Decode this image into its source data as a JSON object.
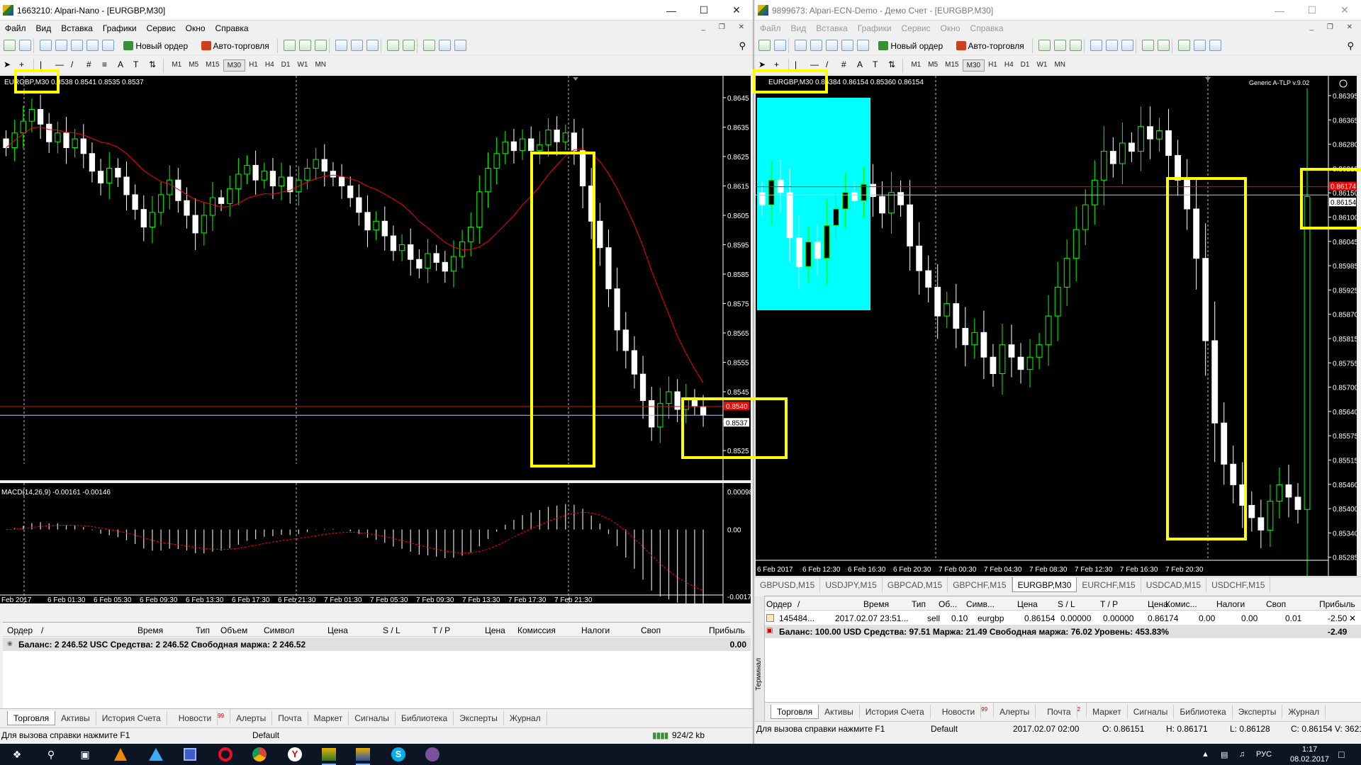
{
  "left": {
    "title": "1663210: Alpari-Nano - [EURGBP,M30]",
    "menu": [
      "Файл",
      "Вид",
      "Вставка",
      "Графики",
      "Сервис",
      "Окно",
      "Справка"
    ],
    "toolbar": {
      "new_order": "Новый ордер",
      "auto_trading": "Авто-торговля"
    },
    "timeframes": [
      "M1",
      "M5",
      "M15",
      "M30",
      "H1",
      "H4",
      "D1",
      "W1",
      "MN"
    ],
    "selected_timeframe": "M30",
    "chart_header": "EURGBP,M30  0.8538 0.8541 0.8535 0.8537",
    "macd_label": "MACD(14,26,9) -0.00161 -0.00146",
    "yticks": [
      "0.8645",
      "0.8635",
      "0.8625",
      "0.8615",
      "0.8605",
      "0.8595",
      "0.8585",
      "0.8575",
      "0.8565",
      "0.8555",
      "0.8545",
      "0.8535",
      "0.8525"
    ],
    "macd_yticks": [
      "0.00098",
      "0.00",
      "-0.00173"
    ],
    "xticks": [
      "Feb 2017",
      "6 Feb 01:30",
      "6 Feb 05:30",
      "6 Feb 09:30",
      "6 Feb 13:30",
      "6 Feb 17:30",
      "6 Feb 21:30",
      "7 Feb 01:30",
      "7 Feb 05:30",
      "7 Feb 09:30",
      "7 Feb 13:30",
      "7 Feb 17:30",
      "7 Feb 21:30"
    ],
    "ask_label": "0.8540",
    "bid_label": "0.8537",
    "terminal_headers": [
      "Ордер",
      "/",
      "Время",
      "Тип",
      "Объем",
      "Символ",
      "Цена",
      "S / L",
      "T / P",
      "Цена",
      "Комиссия",
      "Налоги",
      "Своп",
      "Прибыль"
    ],
    "balance_line": "Баланс: 2 246.52 USC  Средства: 2 246.52  Свободная маржа: 2 246.52",
    "balance_profit": "0.00",
    "tabs": [
      "Торговля",
      "Активы",
      "История Счета",
      "Новости",
      "Алерты",
      "Почта",
      "Маркет",
      "Сигналы",
      "Библиотека",
      "Эксперты",
      "Журнал"
    ],
    "news_badge": "99",
    "status": {
      "help": "Для вызова справки нажмите F1",
      "profile": "Default",
      "traffic": "924/2 kb"
    }
  },
  "right": {
    "title": "9899673: Alpari-ECN-Demo - Демо Счет - [EURGBP,M30]",
    "menu": [
      "Файл",
      "Вид",
      "Вставка",
      "Графики",
      "Сервис",
      "Окно",
      "Справка"
    ],
    "toolbar": {
      "new_order": "Новый ордер",
      "auto_trading": "Авто-торговля"
    },
    "timeframes": [
      "M1",
      "M5",
      "M15",
      "M30",
      "H1",
      "H4",
      "D1",
      "W1",
      "MN"
    ],
    "selected_timeframe": "M30",
    "chart_header": "EURGBP,M30  0.86384 0.86154 0.85360 0.86154",
    "indicator": "Generic A-TLP v.9.02",
    "yticks": [
      "0.86395",
      "0.86365",
      "0.86280",
      "0.86215",
      "0.86150",
      "0.86100",
      "0.86045",
      "0.85985",
      "0.85925",
      "0.85870",
      "0.85815",
      "0.85755",
      "0.85700",
      "0.85640",
      "0.85575",
      "0.85515",
      "0.85460",
      "0.85400",
      "0.85340",
      "0.85285"
    ],
    "xticks": [
      "6 Feb 2017",
      "6 Feb 12:30",
      "6 Feb 16:30",
      "6 Feb 20:30",
      "7 Feb 00:30",
      "7 Feb 04:30",
      "7 Feb 08:30",
      "7 Feb 12:30",
      "7 Feb 16:30",
      "7 Feb 20:30"
    ],
    "ask_label": "0.86174",
    "bid_label": "0.86154",
    "symbol_tabs": [
      "GBPUSD,M15",
      "USDJPY,M15",
      "GBPCAD,M15",
      "GBPCHF,M15",
      "EURGBP,M30",
      "EURCHF,M15",
      "USDCAD,M15",
      "USDCHF,M15"
    ],
    "selected_symbol": "EURGBP,M30",
    "terminal_headers": [
      "Ордер",
      "/",
      "Время",
      "Тип",
      "Об...",
      "Симв...",
      "Цена",
      "S / L",
      "T / P",
      "Цена",
      "Комис...",
      "Налоги",
      "Своп",
      "Прибыль"
    ],
    "order_row": [
      "145484...",
      "2017.02.07 23:51...",
      "sell",
      "0.10",
      "eurgbp",
      "0.86154",
      "0.00000",
      "0.00000",
      "0.86174",
      "0.00",
      "0.00",
      "0.01",
      "-2.50"
    ],
    "balance_line": "Баланс: 100.00 USD  Средства: 97.51  Маржа: 21.49  Свободная маржа: 76.02  Уровень: 453.83%",
    "balance_profit": "-2.49",
    "side_label": "Терминал",
    "tabs": [
      "Торговля",
      "Активы",
      "История Счета",
      "Новости",
      "Алерты",
      "Почта",
      "Маркет",
      "Сигналы",
      "Библиотека",
      "Эксперты",
      "Журнал"
    ],
    "news_badge": "99",
    "mail_badge": "2",
    "status": {
      "help": "Для вызова справки нажмите F1",
      "profile": "Default",
      "time": "2017.02.07 02:00",
      "open": "O: 0.86151",
      "high": "H: 0.86171",
      "low": "L: 0.86128",
      "close": "C: 0.86154",
      "volume": "V: 3621"
    }
  },
  "taskbar": {
    "lang": "РУС",
    "time": "1:17",
    "date": "08.02.2017",
    "icons": [
      "windows-start-icon",
      "search-icon",
      "task-view-icon",
      "vlc-icon",
      "triangle-app-icon",
      "floppy-icon",
      "opera-icon",
      "chrome-icon",
      "yandex-icon",
      "mt4-icon",
      "mt4-icon-2",
      "skype-icon",
      "viber-icon"
    ]
  },
  "colors": {
    "bull": "#00ff00",
    "bear": "#ffffff",
    "ma": "#ff0000",
    "ask": "#ff0000",
    "bid": "#b4c8e6",
    "highlight": "#ffff00",
    "cyan": "#00ffff"
  },
  "chart_data": [
    {
      "type": "candlestick",
      "name": "EURGBP,M30 (left)",
      "ylim": [
        0.8519,
        0.8651
      ],
      "close": [
        0.8628,
        0.8633,
        0.8637,
        0.8641,
        0.8636,
        0.863,
        0.8633,
        0.8628,
        0.8631,
        0.8626,
        0.862,
        0.8616,
        0.8621,
        0.8618,
        0.8612,
        0.8607,
        0.8601,
        0.8606,
        0.8612,
        0.8617,
        0.861,
        0.8605,
        0.8599,
        0.8605,
        0.8611,
        0.8609,
        0.8614,
        0.8619,
        0.8622,
        0.8617,
        0.862,
        0.8615,
        0.8618,
        0.8613,
        0.8617,
        0.8621,
        0.8624,
        0.862,
        0.8618,
        0.8615,
        0.8611,
        0.8606,
        0.86,
        0.8603,
        0.8598,
        0.8593,
        0.8595,
        0.859,
        0.8587,
        0.8592,
        0.8589,
        0.8586,
        0.8591,
        0.8596,
        0.8601,
        0.8613,
        0.8621,
        0.8626,
        0.863,
        0.8627,
        0.8631,
        0.8627,
        0.8629,
        0.8634,
        0.863,
        0.8633,
        0.8627,
        0.8615,
        0.8603,
        0.8594,
        0.858,
        0.8566,
        0.8559,
        0.8551,
        0.8542,
        0.8533,
        0.8541,
        0.8545,
        0.8539,
        0.8543,
        0.854,
        0.8537
      ]
    },
    {
      "type": "candlestick",
      "name": "EURGBP,M30 (right)",
      "ylim": [
        0.8527,
        0.8644
      ],
      "close": [
        0.8613,
        0.8619,
        0.8616,
        0.8605,
        0.8598,
        0.8604,
        0.86,
        0.8608,
        0.8612,
        0.8616,
        0.8614,
        0.8618,
        0.8615,
        0.8611,
        0.8616,
        0.8613,
        0.8603,
        0.8597,
        0.8593,
        0.8586,
        0.8589,
        0.8583,
        0.8579,
        0.8582,
        0.8576,
        0.8572,
        0.8579,
        0.8576,
        0.8573,
        0.8576,
        0.8579,
        0.8586,
        0.8593,
        0.86,
        0.8607,
        0.8613,
        0.8619,
        0.8626,
        0.8623,
        0.8628,
        0.8626,
        0.8632,
        0.8629,
        0.8631,
        0.8625,
        0.8619,
        0.8612,
        0.86,
        0.858,
        0.856,
        0.855,
        0.8545,
        0.854,
        0.8537,
        0.8534,
        0.8541,
        0.8545,
        0.8542,
        0.8539,
        0.8615
      ]
    }
  ]
}
